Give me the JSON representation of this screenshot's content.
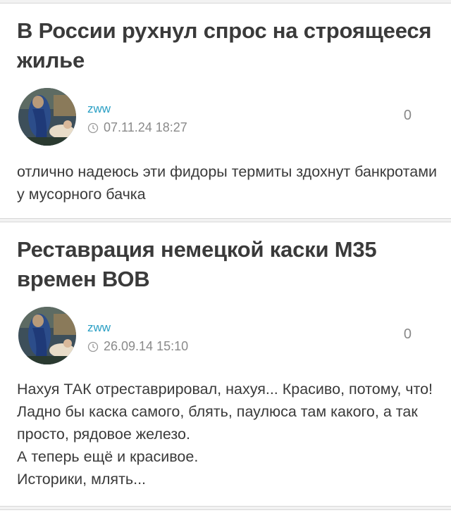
{
  "posts": [
    {
      "title": "В России рухнул спрос на строящееся жилье",
      "author": "zww",
      "date": "07.11.24 18:27",
      "rating": "0",
      "text": "отлично надеюсь эти фидоры термиты здохнут банкротами у мусорного бачка"
    },
    {
      "title": "Реставрация немецкой каски М35 времен ВОВ",
      "author": "zww",
      "date": "26.09.14 15:10",
      "rating": "0",
      "text": "Нахуя ТАК отреставрировал, нахуя... Красиво, потому, что! Ладно бы каска самого, блять, паулюса там какого, а так просто, рядовое железо.\nА теперь ещё и красивое.\nИсторики, млять..."
    }
  ],
  "colors": {
    "page_background": "#f2f2f2",
    "card_background": "#ffffff",
    "author_link": "#2a9fc4",
    "meta_text": "#8a8a8a"
  },
  "icons": {
    "date": "clock-icon",
    "avatar": "avatar"
  }
}
